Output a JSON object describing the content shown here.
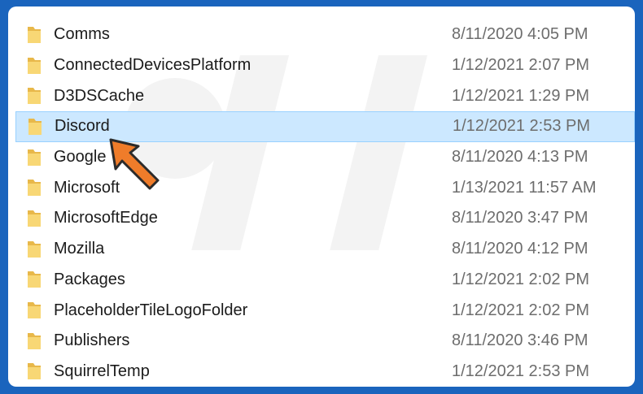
{
  "file_list": {
    "rows": [
      {
        "name": "Comms",
        "date": "8/11/2020 4:05 PM",
        "selected": false
      },
      {
        "name": "ConnectedDevicesPlatform",
        "date": "1/12/2021 2:07 PM",
        "selected": false
      },
      {
        "name": "D3DSCache",
        "date": "1/12/2021 1:29 PM",
        "selected": false
      },
      {
        "name": "Discord",
        "date": "1/12/2021 2:53 PM",
        "selected": true
      },
      {
        "name": "Google",
        "date": "8/11/2020 4:13 PM",
        "selected": false
      },
      {
        "name": "Microsoft",
        "date": "1/13/2021 11:57 AM",
        "selected": false
      },
      {
        "name": "MicrosoftEdge",
        "date": "8/11/2020 3:47 PM",
        "selected": false
      },
      {
        "name": "Mozilla",
        "date": "8/11/2020 4:12 PM",
        "selected": false
      },
      {
        "name": "Packages",
        "date": "1/12/2021 2:02 PM",
        "selected": false
      },
      {
        "name": "PlaceholderTileLogoFolder",
        "date": "1/12/2021 2:02 PM",
        "selected": false
      },
      {
        "name": "Publishers",
        "date": "8/11/2020 3:46 PM",
        "selected": false
      },
      {
        "name": "SquirrelTemp",
        "date": "1/12/2021 2:53 PM",
        "selected": false
      }
    ]
  },
  "icons": {
    "folder": "folder-icon",
    "pointer": "arrow-pointer-icon"
  },
  "colors": {
    "frame_border": "#1a64bd",
    "selection_bg": "#cce8ff",
    "selection_border": "#99d1ff",
    "folder_yellow": "#f8d775",
    "arrow_orange": "#ef7c2a"
  }
}
